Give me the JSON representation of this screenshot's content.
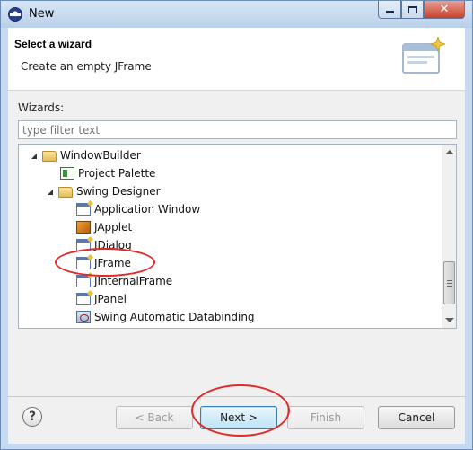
{
  "window": {
    "title": "New",
    "minimize_icon": "minimize-icon",
    "maximize_icon": "maximize-icon",
    "close_glyph": "✕"
  },
  "header": {
    "title": "Select a wizard",
    "description": "Create an empty JFrame"
  },
  "wizards": {
    "label": "Wizards:",
    "filter_placeholder": "type filter text",
    "filter_value": ""
  },
  "tree": {
    "items": [
      {
        "label": "WindowBuilder",
        "icon": "folder-icon",
        "expanded": true,
        "depth": 0
      },
      {
        "label": "Project Palette",
        "icon": "palette-icon",
        "depth": 1
      },
      {
        "label": "Swing Designer",
        "icon": "folder-icon",
        "expanded": true,
        "depth": 1
      },
      {
        "label": "Application Window",
        "icon": "application-window-icon",
        "depth": 2
      },
      {
        "label": "JApplet",
        "icon": "japplet-icon",
        "depth": 2
      },
      {
        "label": "JDialog",
        "icon": "jdialog-icon",
        "depth": 2
      },
      {
        "label": "JFrame",
        "icon": "jframe-icon",
        "depth": 2,
        "circled": true
      },
      {
        "label": "JInternalFrame",
        "icon": "jinternalframe-icon",
        "depth": 2
      },
      {
        "label": "JPanel",
        "icon": "jpanel-icon",
        "depth": 2
      },
      {
        "label": "Swing Automatic Databinding",
        "icon": "databinding-icon",
        "depth": 2
      }
    ]
  },
  "buttons": {
    "help": "?",
    "back": "< Back",
    "next": "Next >",
    "finish": "Finish",
    "cancel": "Cancel"
  },
  "colors": {
    "highlight_circle": "#e12a2a",
    "default_button_border": "#3c7fb1"
  }
}
